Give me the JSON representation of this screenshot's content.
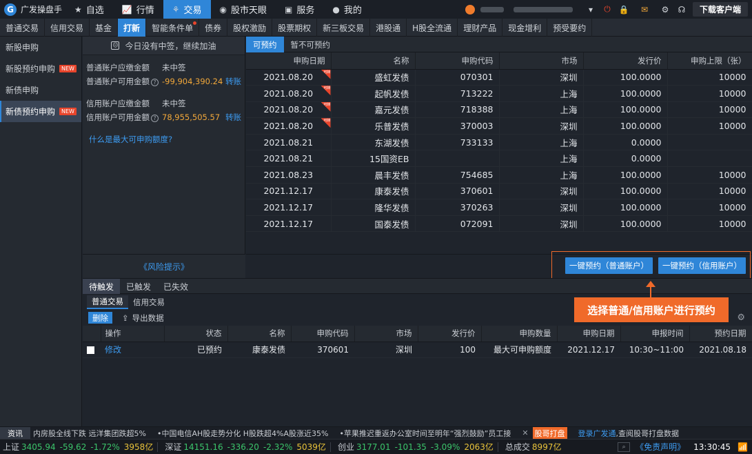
{
  "app": {
    "title": "广发操盘手"
  },
  "topnav": [
    {
      "label": "自选",
      "icon": "star-icon"
    },
    {
      "label": "行情",
      "icon": "chart-icon"
    },
    {
      "label": "交易",
      "icon": "trade-icon"
    },
    {
      "label": "股市天眼",
      "icon": "eye-icon"
    },
    {
      "label": "服务",
      "icon": "briefcase-icon"
    },
    {
      "label": "我的",
      "icon": "user-icon"
    }
  ],
  "download_label": "下载客户端",
  "subnav": [
    "普通交易",
    "信用交易",
    "基金",
    "打新",
    "智能条件单",
    "债券",
    "股权激励",
    "股票期权",
    "新三板交易",
    "港股通",
    "H股全流通",
    "理财产品",
    "现金增利",
    "预受要约"
  ],
  "sidebar": [
    {
      "label": "新股申购",
      "new": ""
    },
    {
      "label": "新股预约申购",
      "new": "NEW"
    },
    {
      "label": "新债申购",
      "new": ""
    },
    {
      "label": "新债预约申购",
      "new": "NEW"
    }
  ],
  "left": {
    "notice": "今日没有中签，继续加油",
    "normal_due_label": "普通账户应缴金额",
    "normal_due_value": "未中签",
    "normal_avail_label": "普通账户可用金额",
    "normal_avail_value": "-99,904,390.24",
    "credit_due_label": "信用账户应缴金额",
    "credit_due_value": "未中签",
    "credit_avail_label": "信用账户可用金额",
    "credit_avail_value": "78,955,505.57",
    "transfer": "转账",
    "question_mark": "?",
    "max_link": "什么是最大可申购额度?",
    "risk": "《风险提示》"
  },
  "main_tabs": [
    "可预约",
    "暂不可预约"
  ],
  "main_table": {
    "headers": [
      "申购日期",
      "名称",
      "申购代码",
      "市场",
      "发行价",
      "申购上限（张）"
    ],
    "badge_text": "可转",
    "rows": [
      [
        "2021.08.20",
        "盛虹发债",
        "070301",
        "深圳",
        "100.0000",
        "10000"
      ],
      [
        "2021.08.20",
        "起帆发债",
        "713222",
        "上海",
        "100.0000",
        "10000"
      ],
      [
        "2021.08.20",
        "嘉元发债",
        "718388",
        "上海",
        "100.0000",
        "10000"
      ],
      [
        "2021.08.20",
        "乐普发债",
        "370003",
        "深圳",
        "100.0000",
        "10000"
      ],
      [
        "2021.08.21",
        "东湖发债",
        "733133",
        "上海",
        "0.0000",
        ""
      ],
      [
        "2021.08.21",
        "15国资EB",
        "",
        "上海",
        "0.0000",
        ""
      ],
      [
        "2021.08.23",
        "晨丰发债",
        "754685",
        "上海",
        "100.0000",
        "10000"
      ],
      [
        "2021.12.17",
        "康泰发债",
        "370601",
        "深圳",
        "100.0000",
        "10000"
      ],
      [
        "2021.12.17",
        "隆华发债",
        "370263",
        "深圳",
        "100.0000",
        "10000"
      ],
      [
        "2021.12.17",
        "国泰发债",
        "072091",
        "深圳",
        "100.0000",
        "10000"
      ]
    ]
  },
  "buttons": {
    "normal": "一键预约（普通账户）",
    "credit": "一键预约（信用账户）"
  },
  "callout": "选择普通/信用账户进行预约",
  "bottom_tabs": [
    "待触发",
    "已触发",
    "已失效"
  ],
  "bottom_subtabs": [
    "普通交易",
    "信用交易"
  ],
  "toolbar": {
    "delete": "删除",
    "export": "导出数据"
  },
  "bottom_table": {
    "headers": [
      "",
      "操作",
      "状态",
      "名称",
      "申购代码",
      "市场",
      "发行价",
      "申购数量",
      "申购日期",
      "申报时间",
      "预约日期"
    ],
    "rows": [
      [
        "",
        "修改",
        "已预约",
        "康泰发债",
        "370601",
        "深圳",
        "100",
        "最大可申购额度",
        "2021.12.17",
        "10:30~11:00",
        "2021.08.18"
      ]
    ]
  },
  "ticker": {
    "tag": "资讯",
    "items": [
      "内房股全线下跌 远洋集团跌超5%",
      "•中国电信AH股走势分化 H股跌超4%A股涨近35%",
      "•苹果推迟重返办公室时间至明年“强烈鼓励”员工接"
    ],
    "gg": "股哥打盘",
    "login": "登录广发通",
    "login_tail": ",查阅股哥打盘数据"
  },
  "status": {
    "sh": {
      "name": "上证",
      "price": "3405.94",
      "chg": "-59.62",
      "pct": "-1.72%",
      "vol": "3958亿"
    },
    "sz": {
      "name": "深证",
      "price": "14151.16",
      "chg": "-336.20",
      "pct": "-2.32%",
      "vol": "5039亿"
    },
    "cy": {
      "name": "创业",
      "price": "3177.01",
      "chg": "-101.35",
      "pct": "-3.09%",
      "vol": "2063亿"
    },
    "total_label": "总成交",
    "total": "8997亿",
    "disclaimer": "《免责声明》",
    "time": "13:30:45"
  },
  "colors": {
    "accent": "#2f86d8",
    "highlight": "#f06a2a",
    "up": "#f2a83a",
    "down": "#3bc46a"
  }
}
